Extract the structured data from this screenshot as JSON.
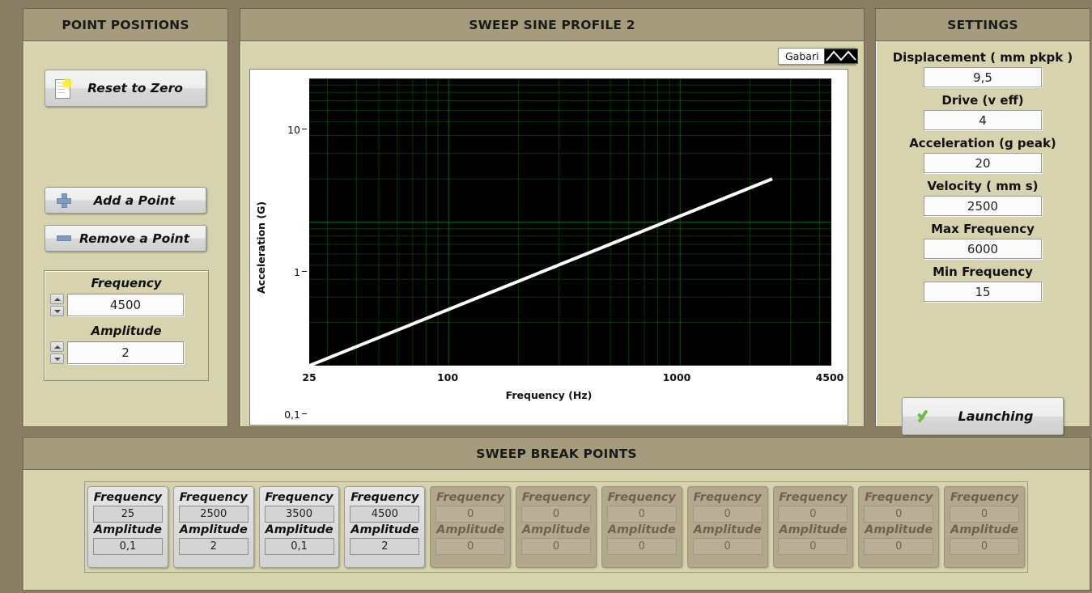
{
  "point_positions": {
    "title": "POINT POSITIONS",
    "reset_button": {
      "label": "Reset to Zero",
      "icon": "page-icon"
    },
    "add_button": {
      "label": "Add a Point",
      "icon": "plus-icon"
    },
    "remove_button": {
      "label": "Remove a Point",
      "icon": "minus-icon"
    },
    "frequency": {
      "label": "Frequency",
      "value": "4500"
    },
    "amplitude": {
      "label": "Amplitude",
      "value": "2"
    }
  },
  "profile": {
    "title": "SWEEP SINE PROFILE 2",
    "legend": {
      "name": "Gabari",
      "icon": "plot-line-icon"
    }
  },
  "settings": {
    "title": "SETTINGS",
    "fields": [
      {
        "label": "Displacement ( mm pkpk )",
        "value": "9,5"
      },
      {
        "label": "Drive (v eff)",
        "value": "4"
      },
      {
        "label": "Acceleration (g peak)",
        "value": "20"
      },
      {
        "label": "Velocity ( mm s)",
        "value": "2500"
      },
      {
        "label": "Max Frequency",
        "value": "6000"
      },
      {
        "label": "Min Frequency",
        "value": "15"
      }
    ],
    "launch_button": {
      "label": "Launching",
      "icon": "check-icon"
    }
  },
  "break_points": {
    "title": "SWEEP BREAK POINTS",
    "frequency_label": "Frequency",
    "amplitude_label": "Amplitude",
    "cards": [
      {
        "frequency": "25",
        "amplitude": "0,1",
        "enabled": true
      },
      {
        "frequency": "2500",
        "amplitude": "2",
        "enabled": true
      },
      {
        "frequency": "3500",
        "amplitude": "0,1",
        "enabled": true
      },
      {
        "frequency": "4500",
        "amplitude": "2",
        "enabled": true
      },
      {
        "frequency": "0",
        "amplitude": "0",
        "enabled": false
      },
      {
        "frequency": "0",
        "amplitude": "0",
        "enabled": false
      },
      {
        "frequency": "0",
        "amplitude": "0",
        "enabled": false
      },
      {
        "frequency": "0",
        "amplitude": "0",
        "enabled": false
      },
      {
        "frequency": "0",
        "amplitude": "0",
        "enabled": false
      },
      {
        "frequency": "0",
        "amplitude": "0",
        "enabled": false
      },
      {
        "frequency": "0",
        "amplitude": "0",
        "enabled": false
      }
    ]
  },
  "colors": {
    "window_background": "#8a7f64",
    "panel_background": "#d6d3ae",
    "panel_header": "#a69c7d",
    "plot_background": "#000000",
    "plot_grid": "#0b5c0b",
    "trace": "#ffffff",
    "disabled_card": "#b3a88e"
  },
  "chart_data": {
    "type": "line",
    "title": "SWEEP SINE PROFILE 2",
    "xlabel": "Frequency (Hz)",
    "ylabel": "Acceleration (G)",
    "xscale": "log",
    "yscale": "log",
    "xlim": [
      25,
      4500
    ],
    "ylim": [
      0.1,
      10
    ],
    "xticks": [
      25,
      100,
      1000,
      4500
    ],
    "xticklabels": [
      "25",
      "100",
      "1000",
      "4500"
    ],
    "yticks": [
      0.1,
      1,
      10
    ],
    "yticklabels": [
      "0,1",
      "1",
      "10"
    ],
    "grid": true,
    "legend_position": "top-right",
    "series": [
      {
        "name": "Gabari",
        "color": "#ffffff",
        "x": [
          25,
          2500
        ],
        "y": [
          0.1,
          2
        ]
      }
    ]
  }
}
